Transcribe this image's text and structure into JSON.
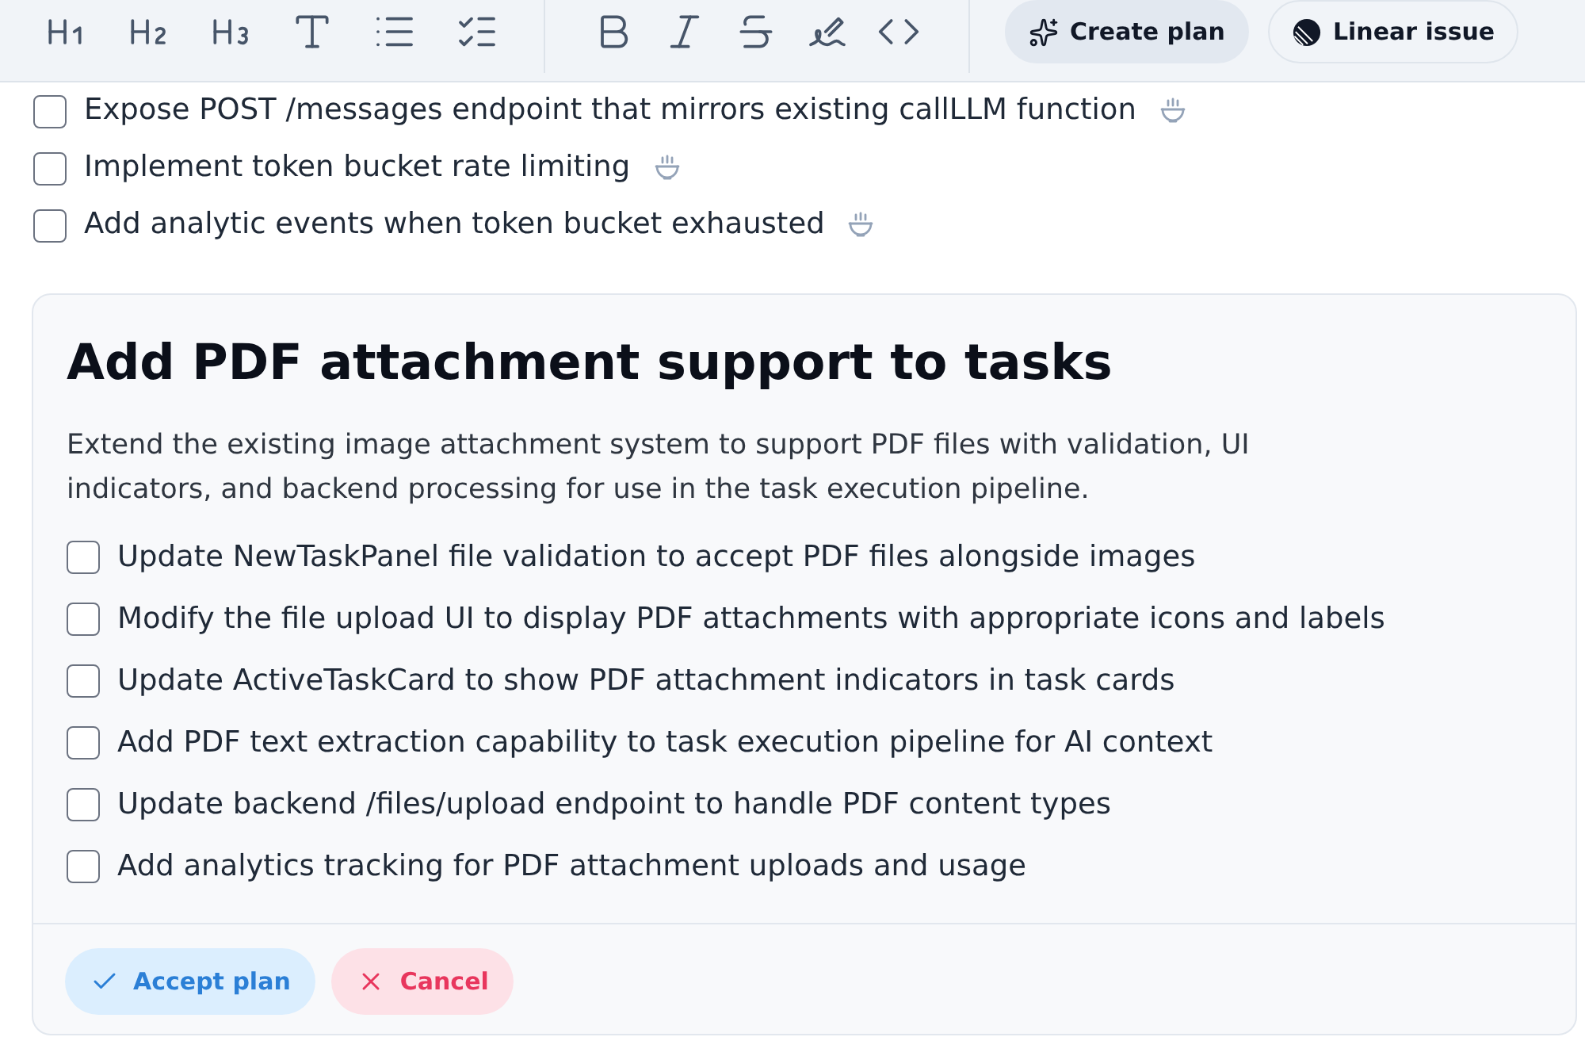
{
  "toolbar": {
    "actions": [
      {
        "kind": "create_plan",
        "label": "Create plan",
        "selected": true
      },
      {
        "kind": "linear_issue",
        "label": "Linear issue",
        "selected": false
      }
    ]
  },
  "checklist": [
    {
      "text": "Expose POST /messages endpoint that mirrors existing callLLM function",
      "checked": false
    },
    {
      "text": "Implement token bucket rate limiting",
      "checked": false
    },
    {
      "text": "Add analytic events when token bucket exhausted",
      "checked": false
    }
  ],
  "plan": {
    "title": "Add PDF attachment support to tasks",
    "description": "Extend the existing image attachment system to support PDF files with validation, UI indicators, and backend processing for use in the task execution pipeline.",
    "steps": [
      {
        "text": "Update NewTaskPanel file validation to accept PDF files alongside images",
        "checked": false
      },
      {
        "text": "Modify the file upload UI to display PDF attachments with appropriate icons and labels",
        "checked": false
      },
      {
        "text": "Update ActiveTaskCard to show PDF attachment indicators in task cards",
        "checked": false
      },
      {
        "text": "Add PDF text extraction capability to task execution pipeline for AI context",
        "checked": false
      },
      {
        "text": "Update backend /files/upload endpoint to handle PDF content types",
        "checked": false
      },
      {
        "text": "Add analytics tracking for PDF attachment uploads and usage",
        "checked": false
      }
    ],
    "actions": [
      {
        "kind": "accept",
        "label": "Accept plan"
      },
      {
        "kind": "cancel",
        "label": "Cancel"
      }
    ]
  }
}
